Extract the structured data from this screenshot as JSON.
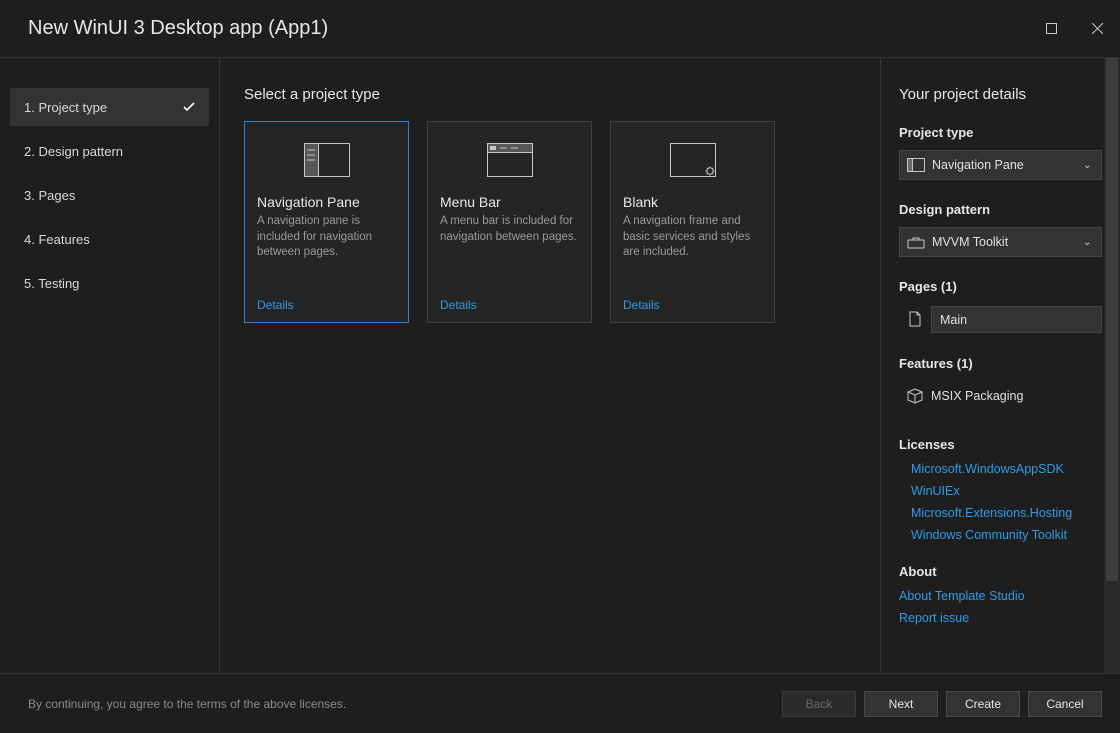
{
  "title": "New WinUI 3 Desktop app (App1)",
  "steps": [
    {
      "label": "1. Project type",
      "active": true,
      "checked": true
    },
    {
      "label": "2. Design pattern"
    },
    {
      "label": "3. Pages"
    },
    {
      "label": "4. Features"
    },
    {
      "label": "5. Testing"
    }
  ],
  "content_heading": "Select a project type",
  "cards": [
    {
      "title": "Navigation Pane",
      "desc": "A navigation pane is included for navigation between pages.",
      "link": "Details",
      "selected": true
    },
    {
      "title": "Menu Bar",
      "desc": "A menu bar is included for navigation between pages.",
      "link": "Details"
    },
    {
      "title": "Blank",
      "desc": "A navigation frame and basic services and styles are included.",
      "link": "Details"
    }
  ],
  "details": {
    "heading": "Your project details",
    "project_type_label": "Project type",
    "project_type_value": "Navigation Pane",
    "design_pattern_label": "Design pattern",
    "design_pattern_value": "MVVM Toolkit",
    "pages_label": "Pages (1)",
    "pages_value": "Main",
    "features_label": "Features (1)",
    "features_value": "MSIX Packaging",
    "licenses_label": "Licenses",
    "licenses": [
      "Microsoft.WindowsAppSDK",
      "WinUIEx",
      "Microsoft.Extensions.Hosting",
      "Windows Community Toolkit"
    ],
    "about_label": "About",
    "about_links": [
      "About Template Studio",
      "Report issue"
    ]
  },
  "footer": {
    "text": "By continuing, you agree to the terms of the above licenses.",
    "back": "Back",
    "next": "Next",
    "create": "Create",
    "cancel": "Cancel"
  }
}
